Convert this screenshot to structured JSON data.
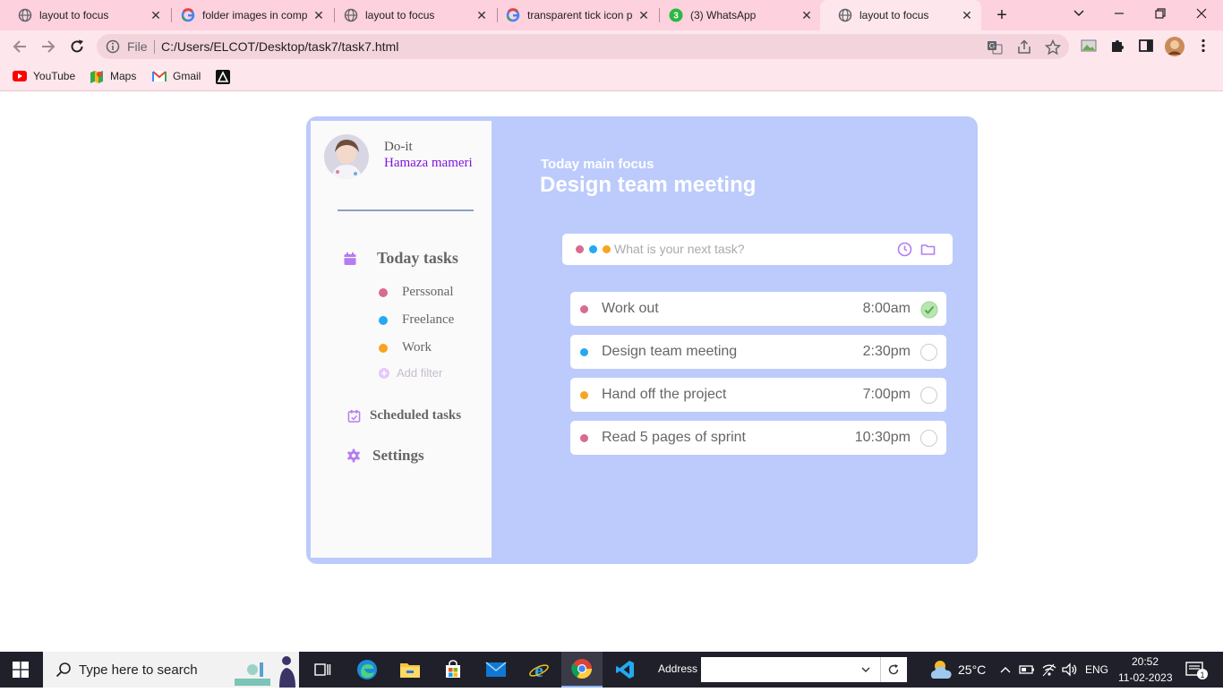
{
  "browser": {
    "tabs": [
      {
        "title": "layout to focus",
        "icon": "globe-icon",
        "active": false
      },
      {
        "title": "folder images in comp",
        "icon": "google-icon",
        "active": false
      },
      {
        "title": "layout to focus",
        "icon": "globe-icon",
        "active": false
      },
      {
        "title": "transparent tick icon p",
        "icon": "google-icon",
        "active": false
      },
      {
        "title": "(3) WhatsApp",
        "icon": "whatsapp-icon",
        "badge": "3",
        "active": false
      },
      {
        "title": "layout to focus",
        "icon": "globe-icon",
        "active": true
      }
    ],
    "omnibox": {
      "scheme_label": "File",
      "url": "C:/Users/ELCOT/Desktop/task7/task7.html"
    },
    "bookmarks": [
      {
        "label": "YouTube",
        "icon": "youtube-icon"
      },
      {
        "label": "Maps",
        "icon": "maps-icon"
      },
      {
        "label": "Gmail",
        "icon": "gmail-icon"
      },
      {
        "label": "",
        "icon": "bookmark-app-icon"
      }
    ],
    "colors": {
      "tabbar": "#fdd1de",
      "toolbar": "#fde6ec"
    }
  },
  "page": {
    "sidebar": {
      "brand": "Do-it",
      "user_name": "Hamaza mameri",
      "today_tasks": "Today tasks",
      "filters": [
        {
          "label": "Perssonal",
          "color": "#d86b8f"
        },
        {
          "label": "Freelance",
          "color": "#25a9f0"
        },
        {
          "label": "Work",
          "color": "#f8a421"
        }
      ],
      "add_filter": "Add filter",
      "scheduled_tasks": "Scheduled tasks",
      "settings": "Settings"
    },
    "main": {
      "focus_label": "Today main focus",
      "focus_title": "Design team meeting",
      "task_input": {
        "placeholder": "What is your next task?",
        "value": ""
      },
      "tasks": [
        {
          "name": "Work out",
          "time": "8:00am",
          "color": "#d86b8f",
          "done": true
        },
        {
          "name": "Design team meeting",
          "time": "2:30pm",
          "color": "#25a9f0",
          "done": false
        },
        {
          "name": "Hand off the project",
          "time": "7:00pm",
          "color": "#f8a421",
          "done": false
        },
        {
          "name": "Read 5 pages of sprint",
          "time": "10:30pm",
          "color": "#d86b8f",
          "done": false
        }
      ]
    },
    "colors": {
      "panel": "#bccbfc",
      "accent": "#b57cf2"
    }
  },
  "taskbar": {
    "search_placeholder": "Type here to search",
    "address_label": "Address",
    "weather": "25°C",
    "language": "ENG",
    "time": "20:52",
    "date": "11-02-2023",
    "notification_count": "1"
  }
}
